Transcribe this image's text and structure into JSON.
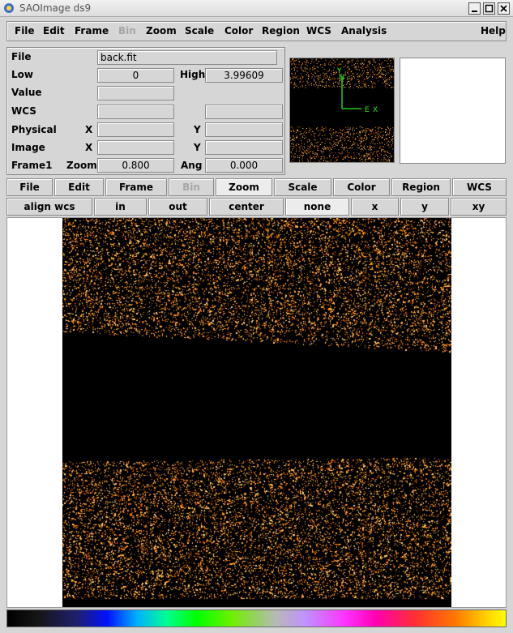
{
  "window": {
    "title": "SAOImage ds9"
  },
  "menubar": {
    "items": [
      {
        "label": "File",
        "disabled": false
      },
      {
        "label": "Edit",
        "disabled": false
      },
      {
        "label": "Frame",
        "disabled": false
      },
      {
        "label": "Bin",
        "disabled": true
      },
      {
        "label": "Zoom",
        "disabled": false
      },
      {
        "label": "Scale",
        "disabled": false
      },
      {
        "label": "Color",
        "disabled": false
      },
      {
        "label": "Region",
        "disabled": false
      },
      {
        "label": "WCS",
        "disabled": false
      },
      {
        "label": "Analysis",
        "disabled": false
      },
      {
        "label": "Help",
        "disabled": false
      }
    ]
  },
  "info": {
    "file_label": "File",
    "file_value": "back.fit",
    "low_label": "Low",
    "low_value": "0",
    "high_label": "High",
    "high_value": "3.99609",
    "value_label": "Value",
    "wcs_label": "WCS",
    "physical_label": "Physical",
    "image_label": "Image",
    "x_label": "X",
    "y_label": "Y",
    "frame_label": "Frame1",
    "zoom_label": "Zoom",
    "zoom_value": "0.800",
    "ang_label": "Ang",
    "ang_value": "0.000"
  },
  "panner": {
    "compass_n": "N",
    "compass_e": "E",
    "compass_x": "X",
    "compass_y": "Y",
    "compass_color": "#22ee22"
  },
  "buttonbar": {
    "major": [
      "File",
      "Edit",
      "Frame",
      "Bin",
      "Zoom",
      "Scale",
      "Color",
      "Region",
      "WCS"
    ],
    "major_disabled": "Bin",
    "major_active": "Zoom",
    "minor": [
      "align wcs",
      "in",
      "out",
      "center",
      "none",
      "x",
      "y",
      "xy"
    ],
    "minor_active": "none"
  },
  "colors": {
    "image_accent": "#ff9a1a",
    "background": "#d6d6d6"
  }
}
